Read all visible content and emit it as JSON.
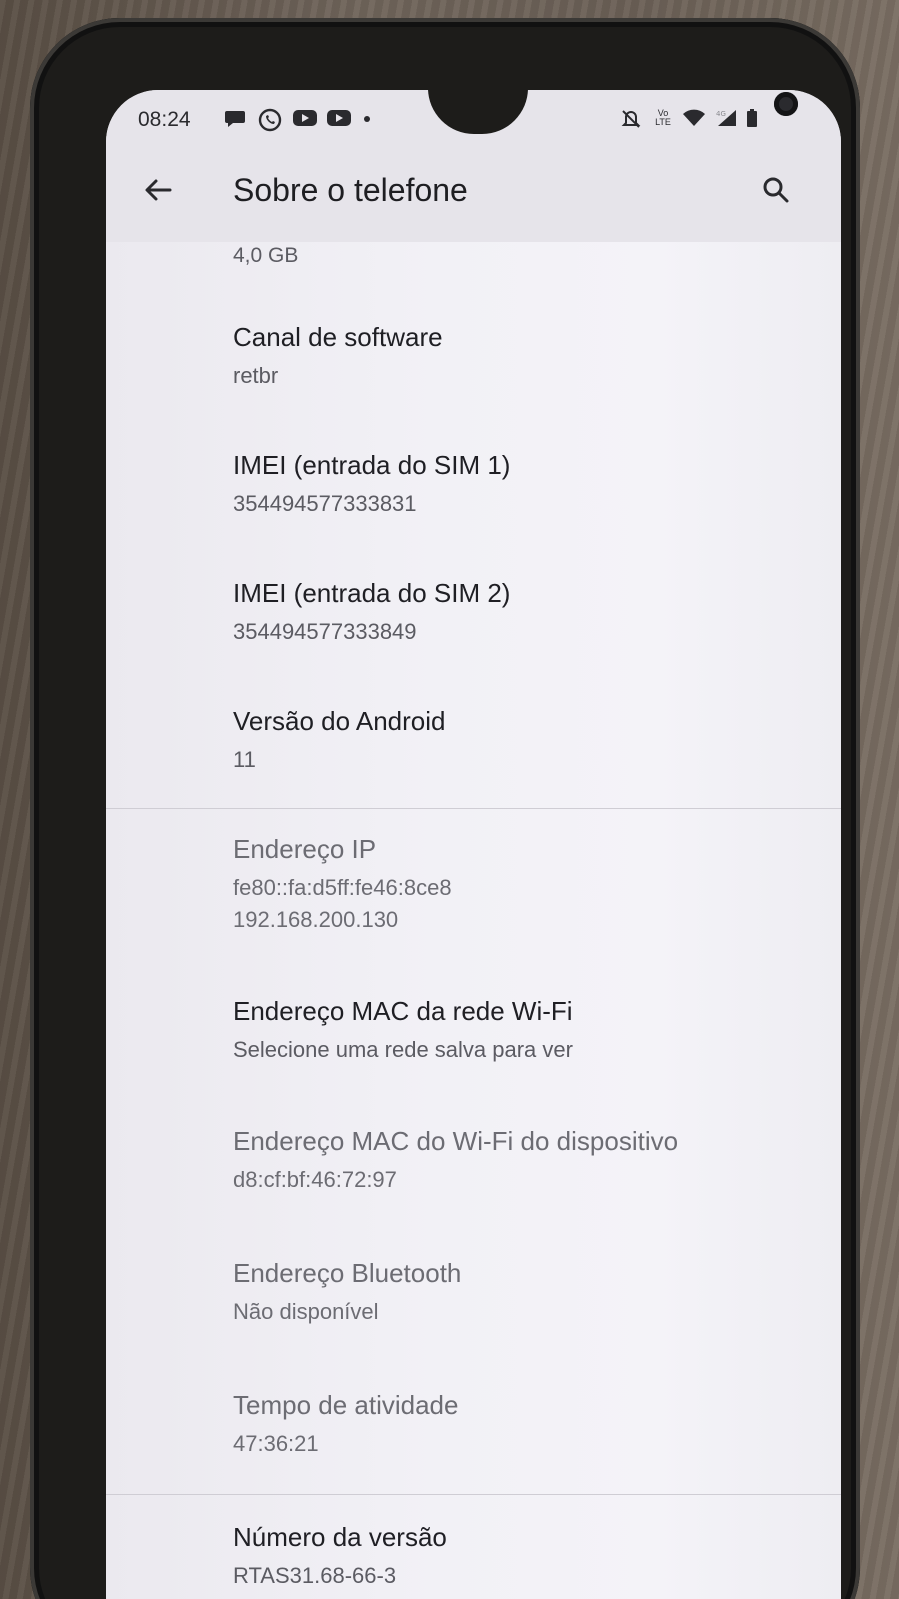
{
  "status_bar": {
    "time": "08:24",
    "lte_label": "Vo LTE",
    "icons_left": [
      "chat-bubble-icon",
      "whatsapp-icon",
      "youtube-icon",
      "youtube-icon",
      "dot-icon"
    ],
    "icons_right": [
      "mute-icon",
      "volte-icon",
      "wifi-icon",
      "signal-icon",
      "battery-icon"
    ]
  },
  "app_bar": {
    "title": "Sobre o telefone"
  },
  "partial_value": "4,0 GB",
  "items": [
    {
      "title": "Canal de software",
      "summary": "retbr",
      "enabled": true
    },
    {
      "title": "IMEI (entrada do SIM 1)",
      "summary": "354494577333831",
      "enabled": true
    },
    {
      "title": "IMEI (entrada do SIM 2)",
      "summary": "354494577333849",
      "enabled": true
    },
    {
      "title": "Versão do Android",
      "summary": "11",
      "enabled": true
    },
    {
      "title": "Endereço IP",
      "summary": "fe80::fa:d5ff:fe46:8ce8",
      "summary2": "192.168.200.130",
      "enabled": false
    },
    {
      "title": "Endereço MAC da rede Wi-Fi",
      "summary": "Selecione uma rede salva para ver",
      "enabled": true
    },
    {
      "title": "Endereço MAC do Wi-Fi do dispositivo",
      "summary": "d8:cf:bf:46:72:97",
      "enabled": false
    },
    {
      "title": "Endereço Bluetooth",
      "summary": "Não disponível",
      "enabled": false
    },
    {
      "title": "Tempo de atividade",
      "summary": "47:36:21",
      "enabled": false
    },
    {
      "title": "Número da versão",
      "summary": "RTAS31.68-66-3",
      "enabled": true
    }
  ]
}
